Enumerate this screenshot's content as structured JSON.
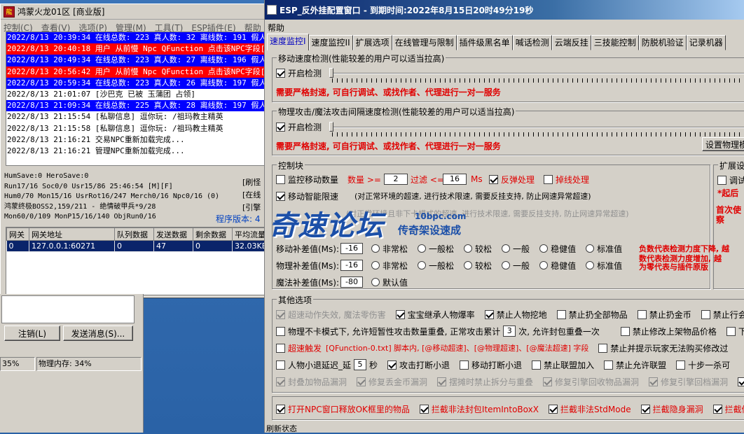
{
  "left_window": {
    "title": "鸿蒙火龙01区 [商业版]",
    "menu": [
      "控制(C)",
      "查看(V)",
      "选项(P)",
      "管理(M)",
      "工具(T)",
      "ESP插件(E)",
      "帮助"
    ],
    "log": [
      {
        "text": "2022/8/13 20:39:34 在线总数: 223 真人数: 32 离线数: 191 假人数",
        "style": "b"
      },
      {
        "text": "2022/8/13 20:40:18 用户 从前慢 Npc QFunction 点击该NPC字段[@3",
        "style": "r"
      },
      {
        "text": "2022/8/13 20:49:34 在线总数: 223 真人数: 27 离线数: 196 假人数",
        "style": "b"
      },
      {
        "text": "2022/8/13 20:56:42 用户 从前慢 Npc QFunction 点击该NPC字段[@3",
        "style": "r"
      },
      {
        "text": "2022/8/13 20:59:34 在线总数: 223 真人数: 26 离线数: 197 假人数",
        "style": "b"
      },
      {
        "text": "2022/8/13 21:01:07 [沙巴克 已被 玉蒲团 占领]",
        "style": ""
      },
      {
        "text": "2022/8/13 21:09:34 在线总数: 225 真人数: 28 离线数: 197 假人数",
        "style": "b"
      },
      {
        "text": "2022/8/13 21:15:54 [私聊信息] 逗你玩: /祖玛教主精英",
        "style": ""
      },
      {
        "text": "2022/8/13 21:15:58 [私聊信息] 逗你玩: /祖玛教主精英",
        "style": ""
      },
      {
        "text": "2022/8/13 21:16:21 交易NPC重新加载完成...",
        "style": ""
      },
      {
        "text": "2022/8/13 21:16:21 管理NPC重新加载完成...",
        "style": ""
      }
    ],
    "stats": [
      "HumSave:0 HeroSave:0",
      "Run17/16 Soc0/0 Usr15/86            25:46:54 [M][F]",
      "Hum0/70 Mon15/16 UsrRot16/247 Merch0/16 Npc0/16 (0)",
      "鸿蒙终极BOSS2,159/211 - 绝情破甲兵*9/28",
      "Mon60/0/109 MonP15/16/140 ObjRun0/16"
    ],
    "side": [
      "[刷怪",
      "[在线",
      "[引擎"
    ],
    "version": "程序版本: 4",
    "grid_headers": [
      "网关",
      "网关地址",
      "队列数据",
      "发送数据",
      "剩余数据",
      "平均流量"
    ],
    "grid_row": [
      "0",
      "127.0.0.1:60271",
      "0",
      "47",
      "0",
      "32.03KB"
    ],
    "btn_logout": "注销(L)",
    "btn_send": "发送消息(S)...",
    "status1": "35%",
    "status2": "物理内存: 34%"
  },
  "right_window": {
    "title": "ESP_反外挂配置窗口 - 到期时间:2022年8月15日20时49分19秒",
    "menu_help": "帮助",
    "tabs": [
      "速度监控I",
      "速度监控II",
      "扩展选项",
      "在线管理与限制",
      "插件级黑名单",
      "喊话检测",
      "云端反挂",
      "三技能控制",
      "防脱机验证",
      "记录机器"
    ],
    "g1_title": "移动速度检测(性能较差的用户可以适当拉高)",
    "g1_cb": "开启检测",
    "warn": "需要严格封速, 可自行调试、或找作者、代理进行一对一服务",
    "g2_title": "物理攻击/魔法攻击间隔速度检测(性能较差的用户可以适当拉高)",
    "g2_cb": "开启检测",
    "g2_btn": "设置物理模",
    "ctl_title": "控制块",
    "ext_title": "扩展设",
    "ext_cb": "调试",
    "ext_red1": "*起后",
    "ext_red2": "首次使",
    "ext_red3": "察",
    "mon_move": "监控移动数量",
    "mon_count_lbl": "数量 >=",
    "mon_count": "2",
    "mon_filter_lbl": "过滤 <=",
    "mon_filter": "16",
    "mon_ms": "Ms",
    "rebound": "反弹处理",
    "dropline": "掉线处理",
    "smart": "移动智能限速",
    "smart_desc": "(对正常环境的超速, 进行技术限速, 需要反挂支持, 防止网速异常超速)",
    "atk_desc": "(对正常环境且非下卡模式的超速, 进行技术限速, 需要反挂支持, 防止网速异常超速)",
    "move_fix": "移动补差值(Ms):",
    "move_fix_v": "-16",
    "phys_fix": "物理补差值(Ms):",
    "phys_fix_v": "-16",
    "magic_fix": "魔法补差值(Ms):",
    "magic_fix_v": "-80",
    "opts": [
      "非常松",
      "一般松",
      "较松",
      "一般",
      "稳健值",
      "标准值"
    ],
    "default_opt": "默认值",
    "neg_note": [
      "负数代表检测力度下降, 越",
      "数代表检测力度增加, 越",
      "为零代表与插件原版"
    ],
    "other_title": "其他选项",
    "o_r1": [
      "超速动作失效, 魔法零伤害",
      "宝宝继承人物爆率",
      "禁止人物挖地",
      "禁止扔全部物品",
      "禁止扔金币",
      "禁止行会"
    ],
    "o_r2a": "物理不卡模式下, 允许短暂性攻击数量重叠, 正常攻击累计",
    "o_r2v": "3",
    "o_r2b": "次, 允许封包重叠一次",
    "o_r2c": "禁止修改上架物品价格",
    "o_r2d": "下菜",
    "o_r3a": "超速触发",
    "o_r3b": "[QFunction-0.txt] 脚本内, [@移动超速]、[@物理超速]、[@魔法超速] 字段",
    "o_r3c": "禁止并提示玩家无法购买修改过",
    "o_r4a": "人物小退延迟_延",
    "o_r4v": "5",
    "o_r4b": "秒",
    "o_r4c": "攻击打断小退",
    "o_r4d": "移动打断小退",
    "o_r4e": "禁止联盟加入",
    "o_r4f": "禁止允许联盟",
    "o_r4g": "十步一杀可",
    "o_r5": [
      "封叠加物品漏洞",
      "修复丢金币漏洞",
      "摆摊时禁止拆分与重叠",
      "修复引擎回收物品漏洞",
      "修复引擎回档漏洞",
      "开"
    ],
    "o_r6": [
      "打开NPC窗口释放OK框里的物品",
      "拦截非法封包ItemIntoBoxX",
      "拦截非法StdMode",
      "拦截隐身漏洞",
      "拦截修理刷"
    ],
    "footer": "刷新状态"
  },
  "watermark": {
    "main": "奇速论坛",
    "domain": "10bpc.com",
    "sub": "传奇架设速成"
  }
}
